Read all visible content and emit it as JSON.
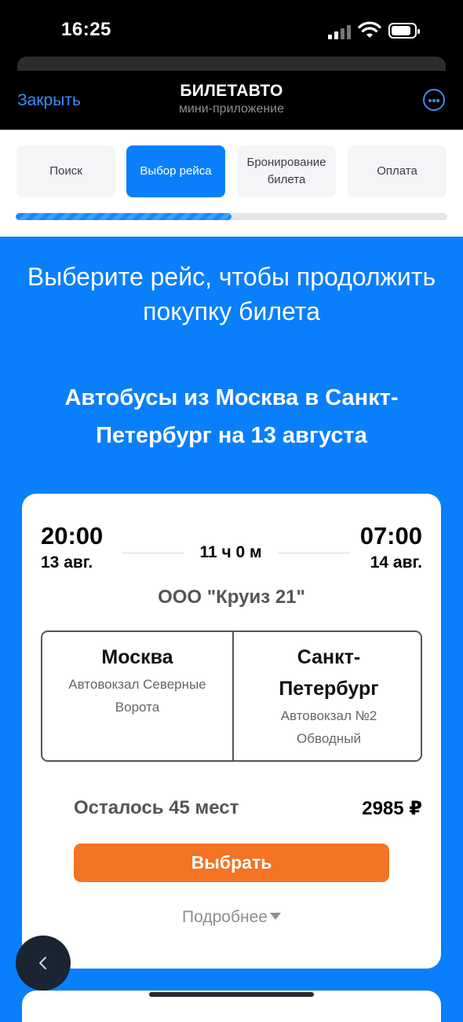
{
  "status_bar": {
    "time": "16:25"
  },
  "nav": {
    "close_label": "Закрыть",
    "title": "БИЛЕТАВТО",
    "subtitle": "мини-приложение"
  },
  "steps": [
    {
      "label": "Поиск",
      "active": false
    },
    {
      "label": "Выбор рейса",
      "active": true
    },
    {
      "label": "Бронирование билета",
      "active": false
    },
    {
      "label": "Оплата",
      "active": false
    }
  ],
  "progress": 0.5,
  "main": {
    "heading": "Выберите рейс, чтобы продолжить покупку билета",
    "subheading": "Автобусы из Москва в Санкт-Петербург на 13 августа"
  },
  "trip": {
    "departure_time": "20:00",
    "departure_date": "13 авг.",
    "duration": "11 ч 0 м",
    "arrival_time": "07:00",
    "arrival_date": "14 авг.",
    "carrier": "ООО \"Круиз 21\"",
    "from_city": "Москва",
    "from_station": "Автовокзал Северные Ворота",
    "to_city": "Санкт-Петербург",
    "to_station": "Автовокзал №2 Обводный",
    "seats_left": "Осталось 45 мест",
    "price": "2985 ₽",
    "select_label": "Выбрать",
    "details_label": "Подробнее"
  },
  "colors": {
    "accent": "#0a7ffb",
    "button": "#f47324",
    "link": "#3a8ef6"
  },
  "icons": [
    "signal-icon",
    "wifi-icon",
    "battery-icon",
    "more-icon",
    "chevron-down-icon",
    "back-icon"
  ]
}
